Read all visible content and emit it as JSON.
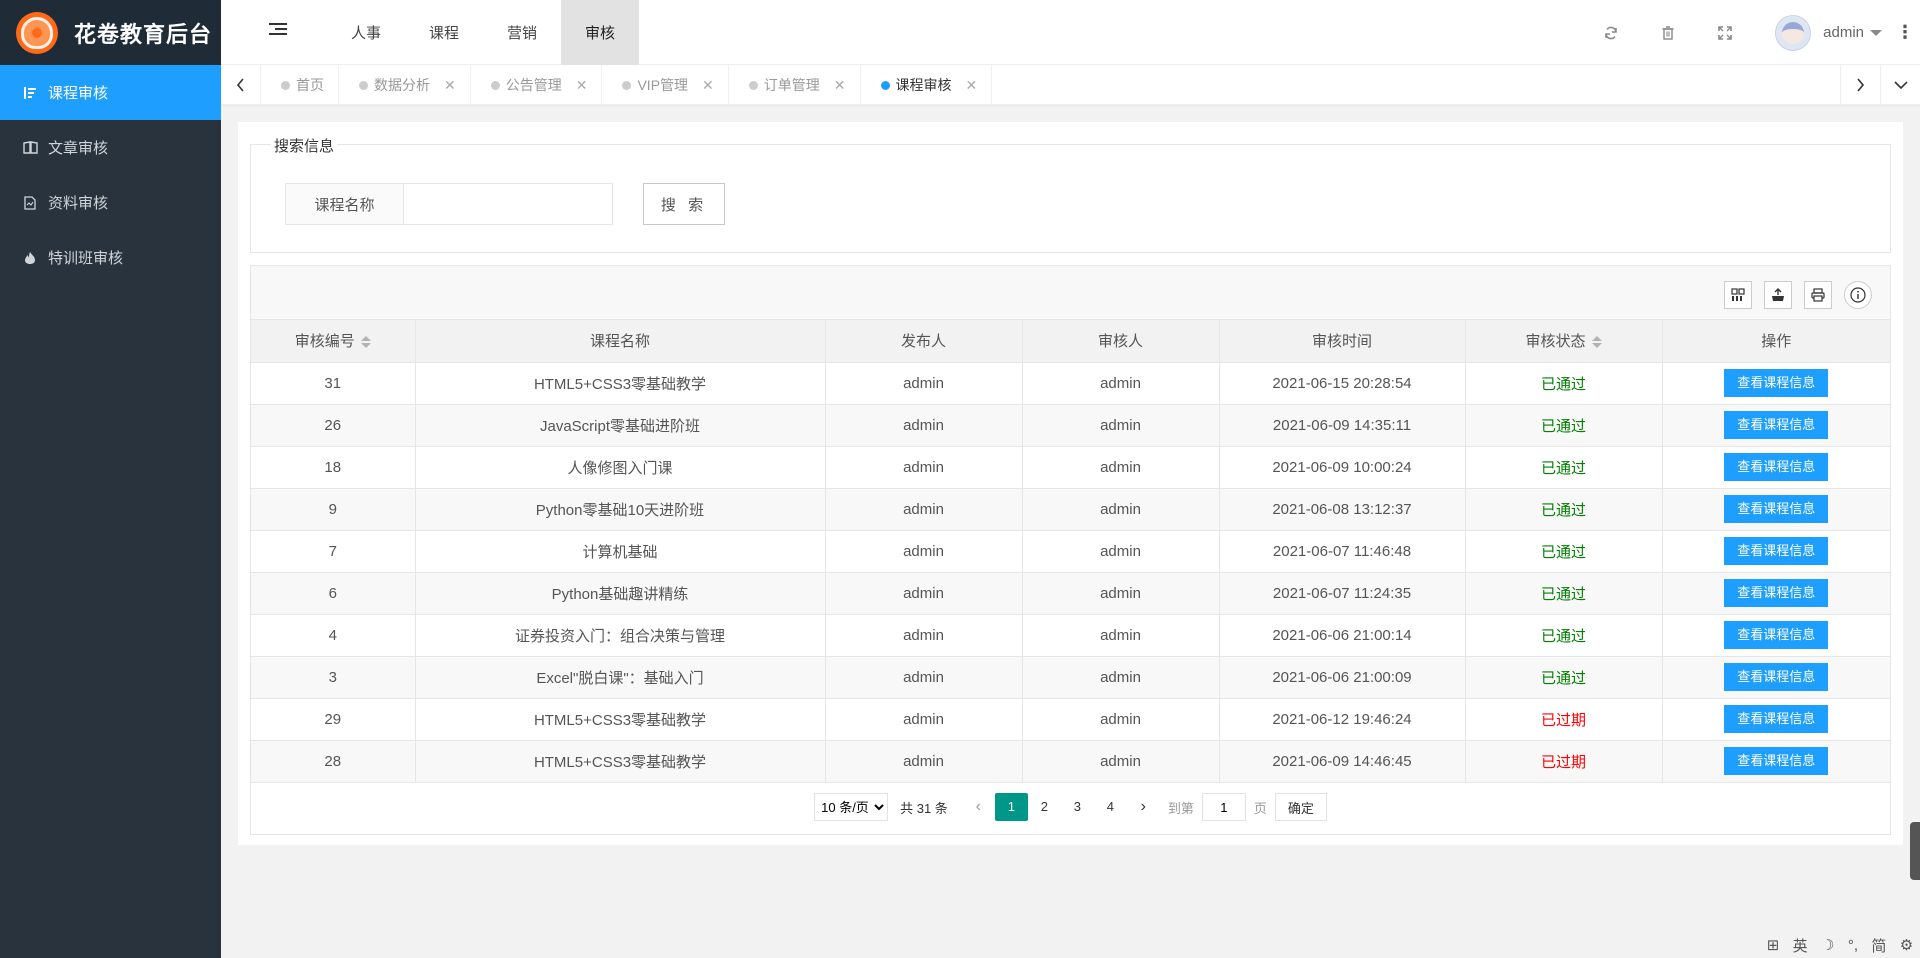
{
  "brand": {
    "name": "花卷教育后台"
  },
  "sidebar": {
    "items": [
      {
        "label": "课程审核",
        "icon": "list-sort-icon",
        "active": true
      },
      {
        "label": "文章审核",
        "icon": "book-icon",
        "active": false
      },
      {
        "label": "资料审核",
        "icon": "document-icon",
        "active": false
      },
      {
        "label": "特训班审核",
        "icon": "fire-icon",
        "active": false
      }
    ]
  },
  "header": {
    "nav": [
      {
        "label": "人事"
      },
      {
        "label": "课程"
      },
      {
        "label": "营销"
      },
      {
        "label": "审核",
        "active": true
      }
    ],
    "user": "admin"
  },
  "tabs": [
    {
      "label": "首页",
      "closable": false
    },
    {
      "label": "数据分析",
      "closable": true
    },
    {
      "label": "公告管理",
      "closable": true
    },
    {
      "label": "VIP管理",
      "closable": true
    },
    {
      "label": "订单管理",
      "closable": true
    },
    {
      "label": "课程审核",
      "closable": true,
      "active": true
    }
  ],
  "search": {
    "legend": "搜索信息",
    "label": "课程名称",
    "value": "",
    "placeholder": "",
    "button": "搜 索"
  },
  "table": {
    "columns": [
      "审核编号",
      "课程名称",
      "发布人",
      "审核人",
      "审核时间",
      "审核状态",
      "操作"
    ],
    "rows": [
      {
        "id": "31",
        "name": "HTML5+CSS3零基础教学",
        "publisher": "admin",
        "reviewer": "admin",
        "time": "2021-06-15 20:28:54",
        "status": "已通过",
        "status_type": "pass",
        "action": "查看课程信息"
      },
      {
        "id": "26",
        "name": "JavaScript零基础进阶班",
        "publisher": "admin",
        "reviewer": "admin",
        "time": "2021-06-09 14:35:11",
        "status": "已通过",
        "status_type": "pass",
        "action": "查看课程信息"
      },
      {
        "id": "18",
        "name": "人像修图入门课",
        "publisher": "admin",
        "reviewer": "admin",
        "time": "2021-06-09 10:00:24",
        "status": "已通过",
        "status_type": "pass",
        "action": "查看课程信息"
      },
      {
        "id": "9",
        "name": "Python零基础10天进阶班",
        "publisher": "admin",
        "reviewer": "admin",
        "time": "2021-06-08 13:12:37",
        "status": "已通过",
        "status_type": "pass",
        "action": "查看课程信息"
      },
      {
        "id": "7",
        "name": "计算机基础",
        "publisher": "admin",
        "reviewer": "admin",
        "time": "2021-06-07 11:46:48",
        "status": "已通过",
        "status_type": "pass",
        "action": "查看课程信息"
      },
      {
        "id": "6",
        "name": "Python基础趣讲精练",
        "publisher": "admin",
        "reviewer": "admin",
        "time": "2021-06-07 11:24:35",
        "status": "已通过",
        "status_type": "pass",
        "action": "查看课程信息"
      },
      {
        "id": "4",
        "name": "证券投资入门：组合决策与管理",
        "publisher": "admin",
        "reviewer": "admin",
        "time": "2021-06-06 21:00:14",
        "status": "已通过",
        "status_type": "pass",
        "action": "查看课程信息"
      },
      {
        "id": "3",
        "name": "Excel\"脱白课\"：基础入门",
        "publisher": "admin",
        "reviewer": "admin",
        "time": "2021-06-06 21:00:09",
        "status": "已通过",
        "status_type": "pass",
        "action": "查看课程信息"
      },
      {
        "id": "29",
        "name": "HTML5+CSS3零基础教学",
        "publisher": "admin",
        "reviewer": "admin",
        "time": "2021-06-12 19:46:24",
        "status": "已过期",
        "status_type": "expired",
        "action": "查看课程信息"
      },
      {
        "id": "28",
        "name": "HTML5+CSS3零基础教学",
        "publisher": "admin",
        "reviewer": "admin",
        "time": "2021-06-09 14:46:45",
        "status": "已过期",
        "status_type": "expired",
        "action": "查看课程信息"
      }
    ]
  },
  "pagination": {
    "page_size": "10 条/页",
    "total": "共 31 条",
    "pages": [
      "1",
      "2",
      "3",
      "4"
    ],
    "current": "1",
    "goto_prefix": "到第",
    "goto_value": "1",
    "goto_suffix": "页",
    "confirm": "确定"
  },
  "ime": [
    "英",
    "简"
  ],
  "colors": {
    "sidebar_bg": "#28333e",
    "accent": "#1e9fff",
    "pass": "#008000",
    "expired": "#ff0000",
    "page_active": "#009688"
  }
}
